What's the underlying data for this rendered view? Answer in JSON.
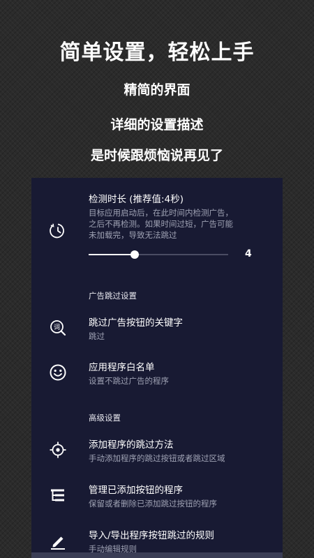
{
  "promo": {
    "title": "简单设置，轻松上手",
    "line1": "精简的界面",
    "line2": "详细的设置描述",
    "line3": "是时候跟烦恼说再见了"
  },
  "settings": {
    "duration": {
      "title": "检测时长 (推荐值:4秒)",
      "desc_line1": "目标应用启动后，在此时间内检测广告，",
      "desc_line2": "之后不再检测。如果时间过短，广告可能",
      "desc_line3": "未加载完，导致无法跳过",
      "slider_value": "4",
      "slider_fraction": 0.33
    },
    "section_ad": "广告跳过设置",
    "keywords": {
      "title": "跳过广告按钮的关键字",
      "desc": "跳过"
    },
    "whitelist": {
      "title": "应用程序白名单",
      "desc": "设置不跳过广告的程序"
    },
    "section_advanced": "高级设置",
    "add_method": {
      "title": "添加程序的跳过方法",
      "desc": "手动添加程序的跳过按钮或者跳过区域"
    },
    "manage": {
      "title": "管理已添加按钮的程序",
      "desc": "保留或者删除已添加跳过按钮的程序"
    },
    "import_export": {
      "title": "导入/导出程序按钮跳过的规则",
      "desc": "手动编辑规则"
    }
  },
  "icons": {
    "duration": "timer-icon",
    "keywords": "word-search-icon",
    "whitelist": "smiley-icon",
    "add_method": "crosshair-icon",
    "manage": "list-tree-icon",
    "import_export": "pencil-icon"
  }
}
